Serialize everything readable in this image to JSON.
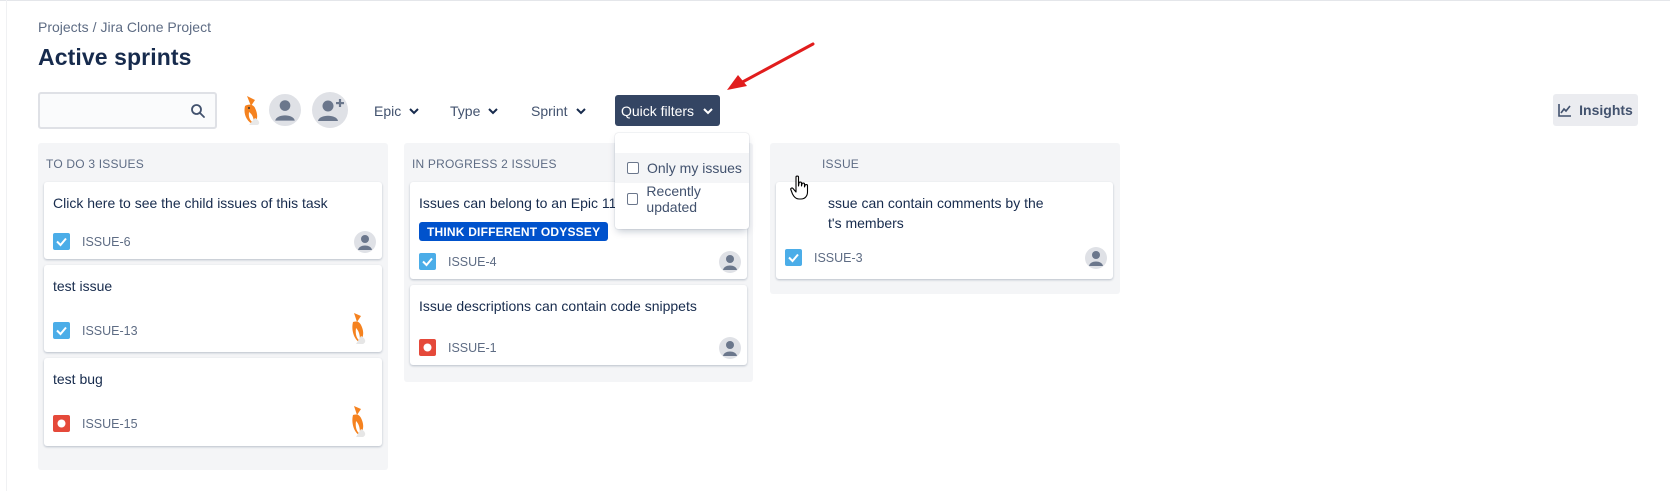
{
  "breadcrumb": {
    "projects": "Projects",
    "separator": "/",
    "project": "Jira Clone Project"
  },
  "page_title": "Active sprints",
  "search": {
    "value": "",
    "placeholder": ""
  },
  "icons": {
    "search": "search-icon",
    "chevron": "chevron-down-icon",
    "insights": "chart-line-icon",
    "add_user": "add-user-icon",
    "user": "user-avatar-icon",
    "task": "task-checkbox-icon",
    "bug": "bug-icon"
  },
  "filters": {
    "epic": "Epic",
    "type": "Type",
    "sprint": "Sprint",
    "quick": "Quick filters"
  },
  "insights": "Insights",
  "quick_filter_menu": [
    {
      "label": "Only my issues",
      "checked": false
    },
    {
      "label": "Recently updated",
      "checked": false
    }
  ],
  "columns": [
    {
      "title": "TO DO 3 ISSUES",
      "cards": [
        {
          "title": "Click here to see the child issues of this task",
          "key": "ISSUE-6",
          "type": "task",
          "assignee": "user"
        },
        {
          "title": "test issue",
          "key": "ISSUE-13",
          "type": "task",
          "assignee": "fox"
        },
        {
          "title": "test bug",
          "key": "ISSUE-15",
          "type": "bug",
          "assignee": "fox"
        }
      ]
    },
    {
      "title": "IN PROGRESS 2 ISSUES",
      "cards": [
        {
          "title": "Issues can belong to an Epic 111",
          "epic": "THINK DIFFERENT ODYSSEY",
          "key": "ISSUE-4",
          "type": "task",
          "assignee": "user"
        },
        {
          "title": "Issue descriptions can contain code snippets",
          "key": "ISSUE-1",
          "type": "bug",
          "assignee": "user"
        }
      ]
    },
    {
      "title": "ISSUE",
      "cards": [
        {
          "title_line1": "ssue can contain comments by the",
          "title_line2": "t's members",
          "key": "ISSUE-3",
          "type": "task",
          "assignee": "user"
        }
      ]
    }
  ],
  "colors": {
    "quick_filter_bg": "#344563",
    "epic_tag": "#0052cc",
    "task": "#4bade8",
    "bug": "#e5493a",
    "arrow": "#e11d1d"
  }
}
